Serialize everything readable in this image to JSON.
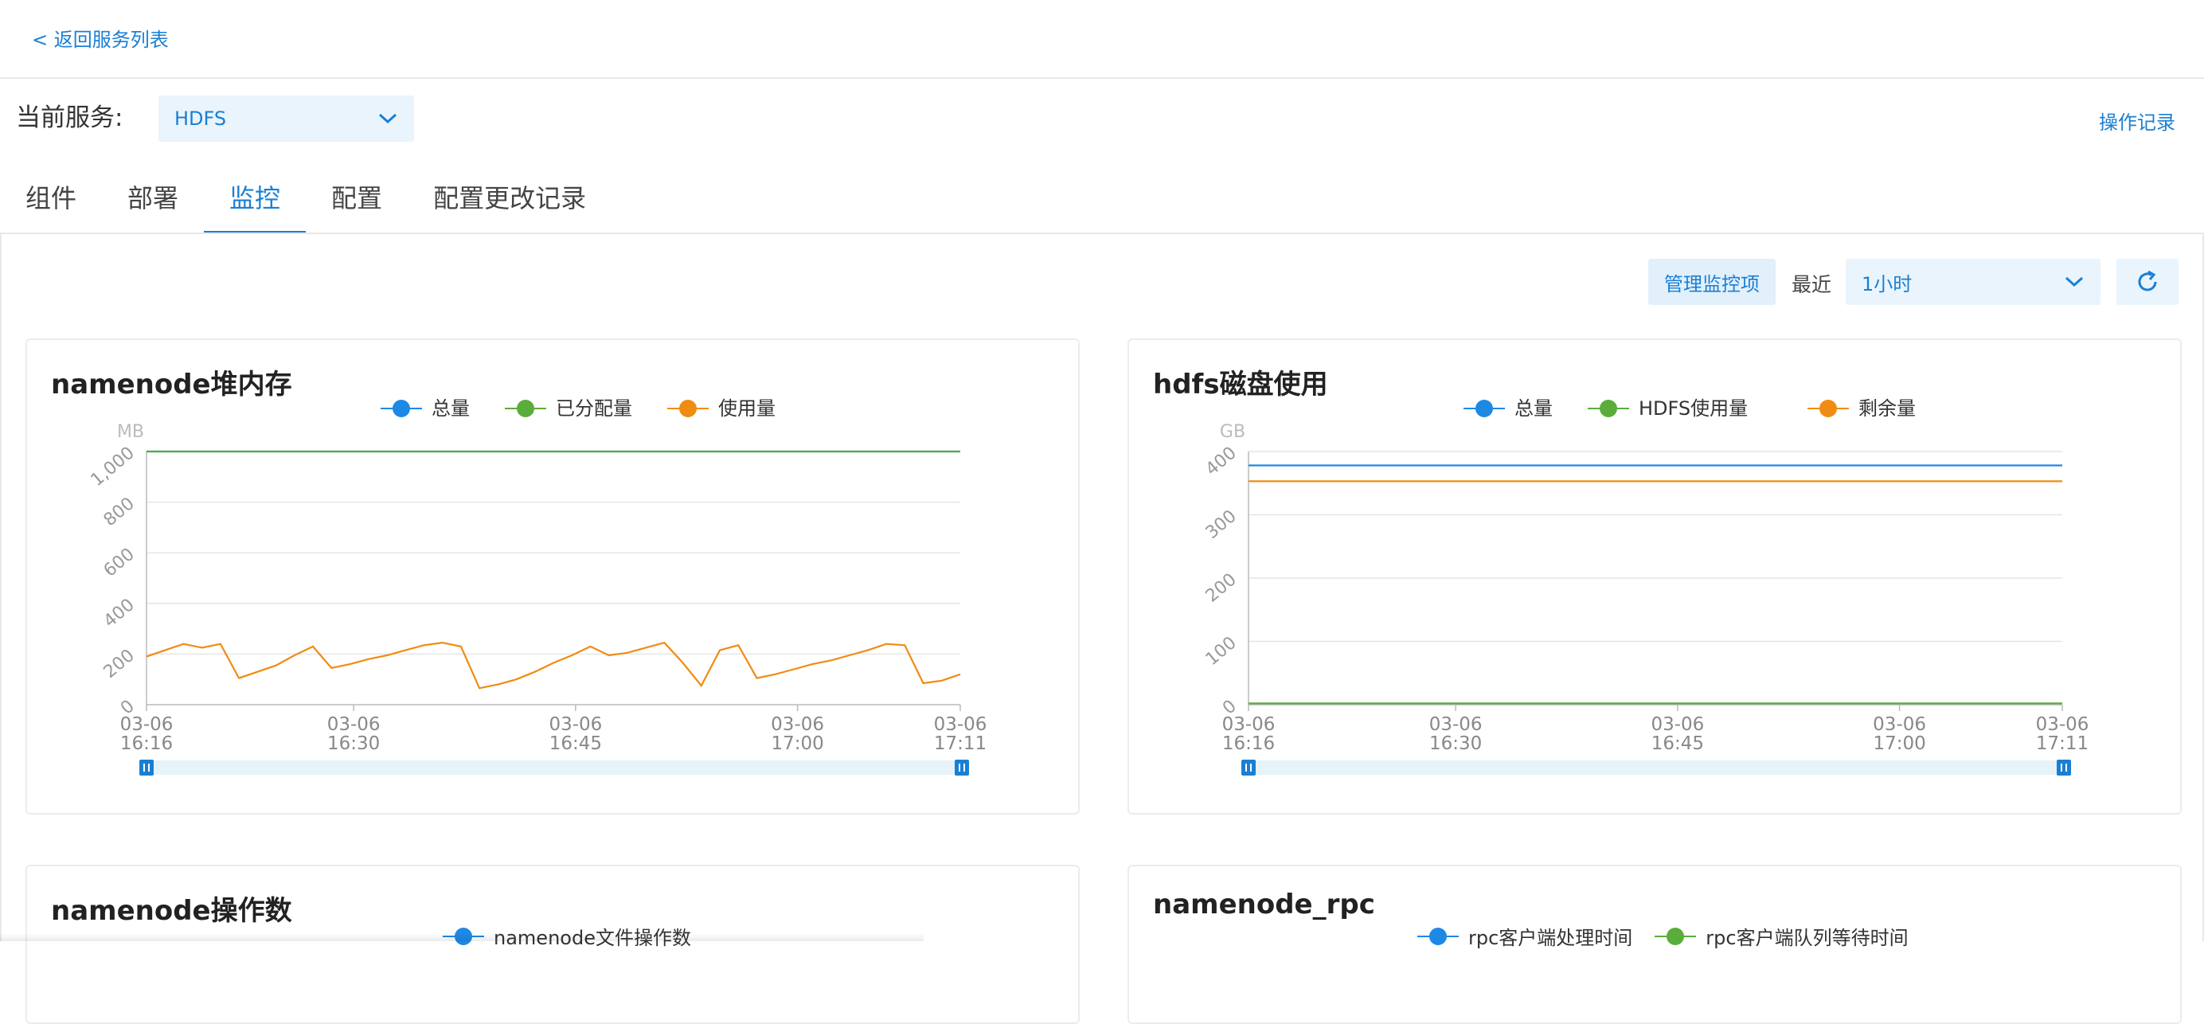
{
  "nav": {
    "back_label": "< 返回服务列表",
    "oplog_label": "操作记录"
  },
  "service": {
    "label": "当前服务:",
    "selected": "HDFS"
  },
  "tabs": [
    {
      "label": "组件",
      "active": false
    },
    {
      "label": "部署",
      "active": false
    },
    {
      "label": "监控",
      "active": true
    },
    {
      "label": "配置",
      "active": false
    },
    {
      "label": "配置更改记录",
      "active": false
    }
  ],
  "toolbar": {
    "manage_label": "管理监控项",
    "recent_label": "最近",
    "range_selected": "1小时"
  },
  "colors": {
    "accent": "#1a7fd4",
    "blue": "#1e88e5",
    "green": "#5aad3a",
    "orange": "#f08c12"
  },
  "chart_data": [
    {
      "type": "line",
      "title": "namenode堆内存",
      "ylabel": "MB",
      "ylim": [
        0,
        1000
      ],
      "yticks": [
        "0",
        "200",
        "400",
        "600",
        "800",
        "1,000"
      ],
      "xticks": [
        [
          "03-06",
          "16:16"
        ],
        [
          "03-06",
          "16:30"
        ],
        [
          "03-06",
          "16:45"
        ],
        [
          "03-06",
          "17:00"
        ],
        [
          "03-06",
          "17:11"
        ]
      ],
      "x_minutes": [
        0,
        14,
        29,
        44,
        55
      ],
      "series": [
        {
          "name": "总量",
          "color": "#1e88e5",
          "values": [
            1000,
            1000
          ]
        },
        {
          "name": "已分配量",
          "color": "#5aad3a",
          "values": [
            1000,
            1000
          ]
        },
        {
          "name": "使用量",
          "color": "#f08c12",
          "values": [
            190,
            215,
            240,
            225,
            240,
            105,
            130,
            155,
            195,
            230,
            145,
            160,
            180,
            195,
            215,
            235,
            245,
            230,
            65,
            80,
            100,
            130,
            165,
            195,
            230,
            195,
            205,
            225,
            245,
            165,
            75,
            215,
            235,
            105,
            120,
            140,
            160,
            175,
            195,
            215,
            240,
            235,
            85,
            95,
            120
          ]
        }
      ]
    },
    {
      "type": "line",
      "title": "hdfs磁盘使用",
      "ylabel": "GB",
      "ylim": [
        0,
        400
      ],
      "yticks": [
        "0",
        "100",
        "200",
        "300",
        "400"
      ],
      "xticks": [
        [
          "03-06",
          "16:16"
        ],
        [
          "03-06",
          "16:30"
        ],
        [
          "03-06",
          "16:45"
        ],
        [
          "03-06",
          "17:00"
        ],
        [
          "03-06",
          "17:11"
        ]
      ],
      "x_minutes": [
        0,
        14,
        29,
        44,
        55
      ],
      "series": [
        {
          "name": "总量",
          "color": "#1e88e5",
          "values": [
            378,
            378
          ]
        },
        {
          "name": "HDFS使用量",
          "color": "#5aad3a",
          "values": [
            2,
            2
          ]
        },
        {
          "name": "剩余量",
          "color": "#f08c12",
          "values": [
            353,
            353
          ]
        }
      ]
    },
    {
      "type": "line",
      "title": "namenode操作数",
      "series": [
        {
          "name": "namenode文件操作数",
          "color": "#1e88e5"
        }
      ]
    },
    {
      "type": "line",
      "title": "namenode_rpc",
      "series": [
        {
          "name": "rpc客户端处理时间",
          "color": "#1e88e5"
        },
        {
          "name": "rpc客户端队列等待时间",
          "color": "#5aad3a"
        }
      ]
    }
  ]
}
